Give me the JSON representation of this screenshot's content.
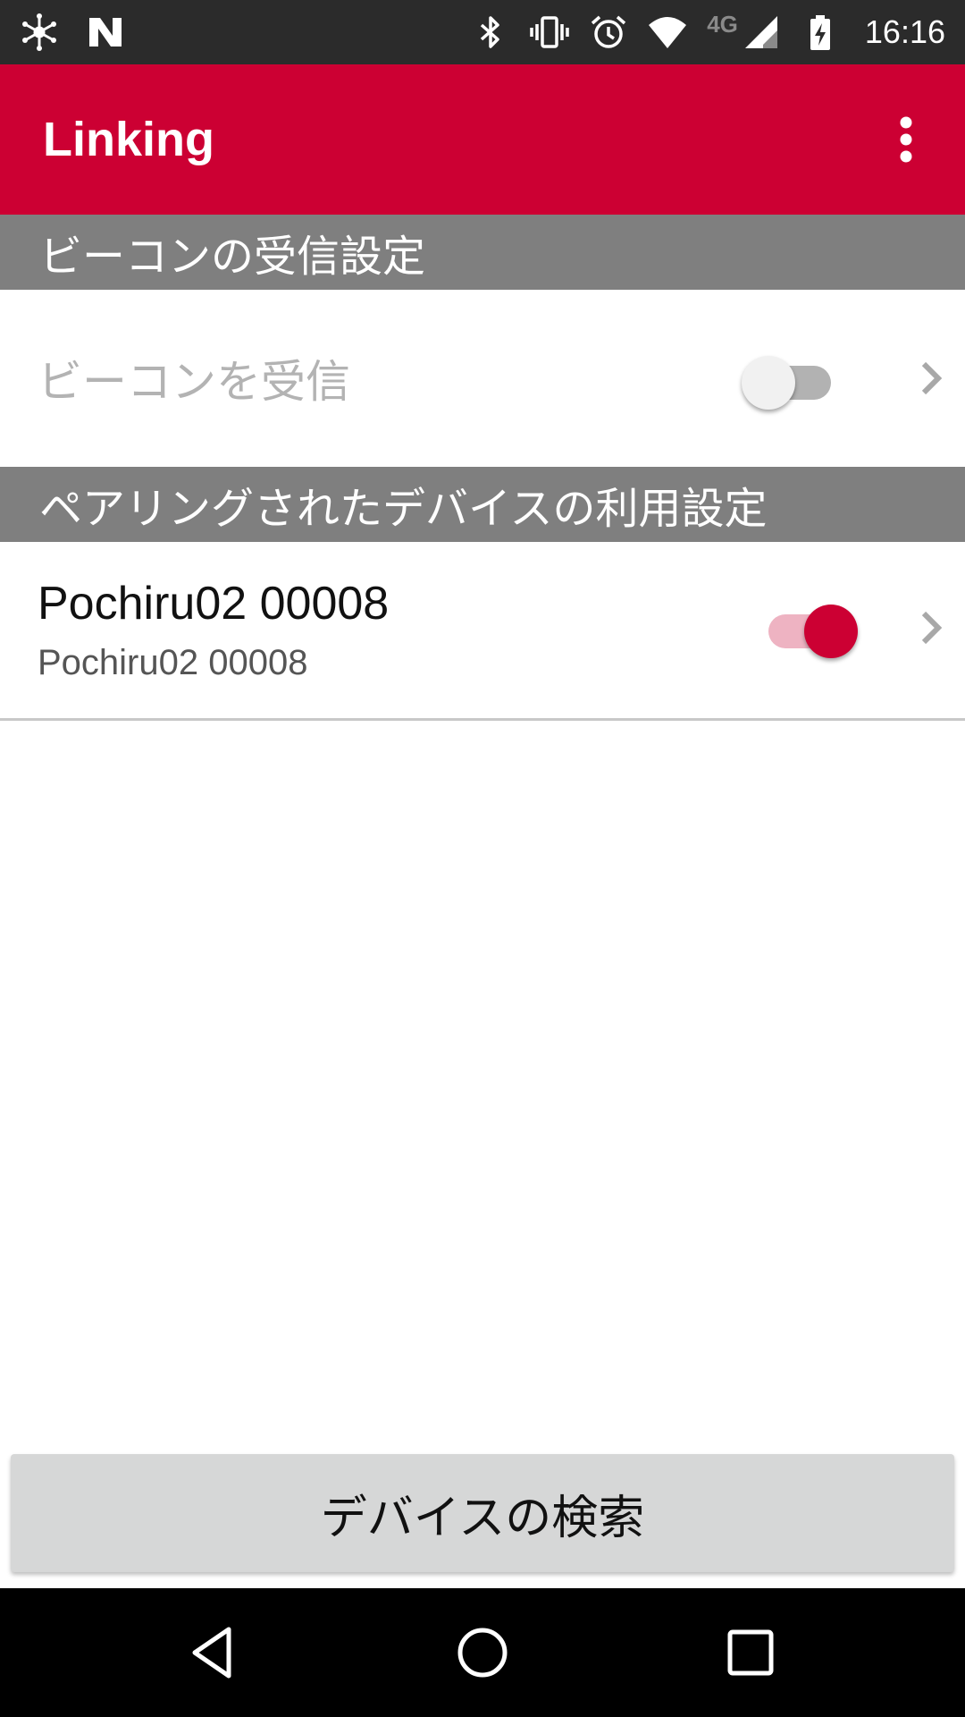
{
  "status_bar": {
    "time": "16:16",
    "network_label": "4G",
    "icons_left": [
      "hub-icon",
      "n-logo-icon"
    ],
    "icons_right": [
      "bluetooth-icon",
      "vibrate-icon",
      "alarm-icon",
      "wifi-icon",
      "cell-signal-icon",
      "battery-charging-icon"
    ]
  },
  "app_bar": {
    "title": "Linking",
    "overflow_icon": "more-vert-icon",
    "color": "#cc0033"
  },
  "sections": [
    {
      "header": "ビーコンの受信設定"
    },
    {
      "header": "ペアリングされたデバイスの利用設定"
    }
  ],
  "beacon_row": {
    "label": "ビーコンを受信",
    "enabled": false,
    "switch_on": false
  },
  "device_row": {
    "title": "Pochiru02 00008",
    "subtitle": "Pochiru02 00008",
    "switch_on": true
  },
  "search_button": {
    "label": "デバイスの検索"
  },
  "nav_bar": {
    "icons": [
      "back-icon",
      "home-icon",
      "recents-icon"
    ]
  }
}
